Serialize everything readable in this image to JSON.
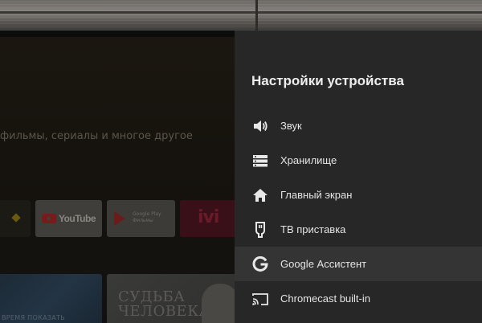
{
  "home": {
    "tagline": "фильмы, сериалы и многое другое",
    "apps": [
      {
        "name": "YouTube"
      },
      {
        "name": "Google Play",
        "sub": "Фильмы"
      },
      {
        "name": "ivi"
      }
    ],
    "previews": [
      {
        "text": "ВРЕМЯ ПОКАЗАТЬ"
      },
      {
        "line1": "СУДЬБА",
        "line2": "ЧЕЛОВЕКА"
      }
    ]
  },
  "settings": {
    "title": "Настройки устройства",
    "items": [
      {
        "label": "Звук",
        "icon": "speaker-icon"
      },
      {
        "label": "Хранилище",
        "icon": "storage-icon"
      },
      {
        "label": "Главный экран",
        "icon": "home-icon"
      },
      {
        "label": "ТВ приставка",
        "icon": "tv-box-icon"
      },
      {
        "label": "Google Ассистент",
        "icon": "google-icon",
        "focused": true
      },
      {
        "label": "Chromecast built-in",
        "icon": "cast-icon"
      }
    ]
  },
  "colors": {
    "panel_bg": "#272727",
    "focused_row": "#343434",
    "text": "#e4e4e4"
  }
}
